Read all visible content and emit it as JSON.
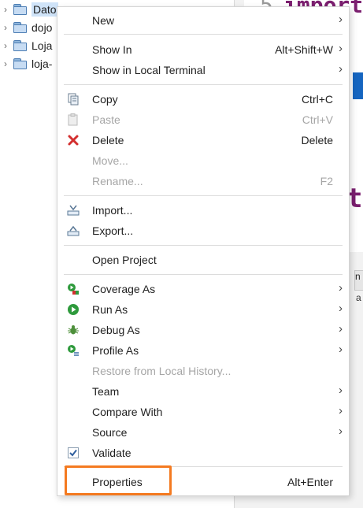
{
  "tree": {
    "items": [
      {
        "label": "Dato",
        "selected": true
      },
      {
        "label": "dojo",
        "selected": false
      },
      {
        "label": "Loja",
        "selected": false
      },
      {
        "label": "loja-",
        "selected": false
      }
    ]
  },
  "editor": {
    "line_number": "5",
    "code_snippet": "import",
    "bracket": "t",
    "tab_text": "n",
    "tab_text2": "a"
  },
  "menu": {
    "new": {
      "label": "New"
    },
    "show_in": {
      "label": "Show In",
      "shortcut": "Alt+Shift+W"
    },
    "show_in_terminal": {
      "label": "Show in Local Terminal"
    },
    "copy": {
      "label": "Copy",
      "shortcut": "Ctrl+C"
    },
    "paste": {
      "label": "Paste",
      "shortcut": "Ctrl+V"
    },
    "delete": {
      "label": "Delete",
      "shortcut": "Delete"
    },
    "move": {
      "label": "Move..."
    },
    "rename": {
      "label": "Rename...",
      "shortcut": "F2"
    },
    "import": {
      "label": "Import..."
    },
    "export": {
      "label": "Export..."
    },
    "open_project": {
      "label": "Open Project"
    },
    "coverage_as": {
      "label": "Coverage As"
    },
    "run_as": {
      "label": "Run As"
    },
    "debug_as": {
      "label": "Debug As"
    },
    "profile_as": {
      "label": "Profile As"
    },
    "restore_history": {
      "label": "Restore from Local History..."
    },
    "team": {
      "label": "Team"
    },
    "compare_with": {
      "label": "Compare With"
    },
    "source": {
      "label": "Source"
    },
    "validate": {
      "label": "Validate"
    },
    "properties": {
      "label": "Properties",
      "shortcut": "Alt+Enter"
    }
  },
  "colors": {
    "highlight": "#f47a20",
    "delete_icon": "#d32f2f",
    "run_icon": "#2e9a3c"
  }
}
